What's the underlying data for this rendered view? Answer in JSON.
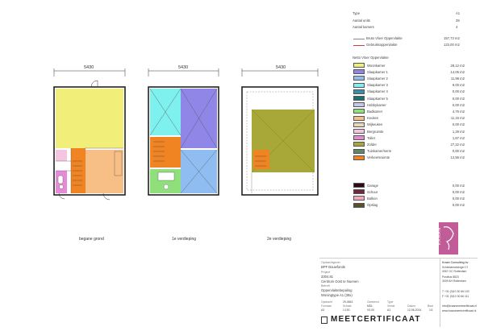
{
  "plans": {
    "dimension": "5430",
    "labels": [
      "begane grond",
      "1e verdieping",
      "2e verdieping"
    ]
  },
  "summary": {
    "type_label": "Type",
    "type_value": "A1",
    "aantal_units_label": "Aantal units",
    "aantal_units_value": "39",
    "aantal_kamers_label": "Aantal kamers",
    "aantal_kamers_value": "4",
    "bvo_label": "Bruto Vloer Oppervlakte",
    "bvo_value": "157,73 m2",
    "go_label": "Gebruiksoppervlakte",
    "go_value": "123,00 m2",
    "nvo_heading": "Netto Vloer Oppervlakte"
  },
  "legend": [
    {
      "label": "Woonkamer",
      "value": "28,12 m2",
      "color": "#f2ee7a"
    },
    {
      "label": "Slaapkamer 1",
      "value": "14,05 m2",
      "color": "#8f86e8"
    },
    {
      "label": "Slaapkamer 2",
      "value": "11,98 m2",
      "color": "#8fbdf2"
    },
    {
      "label": "Slaapkamer 3",
      "value": "9,00 m2",
      "color": "#7ef0ee"
    },
    {
      "label": "Slaapkamer 4",
      "value": "0,00 m2",
      "color": "#3a8fa8"
    },
    {
      "label": "Slaapkamer 5",
      "value": "0,00 m2",
      "color": "#1e6f6f"
    },
    {
      "label": "Hobbykamer",
      "value": "0,00 m2",
      "color": "#c4c8ec"
    },
    {
      "label": "Badkamer",
      "value": "4,76 m2",
      "color": "#8fe07a"
    },
    {
      "label": "Keuken",
      "value": "11,15 m2",
      "color": "#f7be86"
    },
    {
      "label": "Wijkeuken",
      "value": "0,00 m2",
      "color": "#ead7b7"
    },
    {
      "label": "Bergruimte",
      "value": "1,29 m2",
      "color": "#f5c4e0"
    },
    {
      "label": "Toilet",
      "value": "1,67 m2",
      "color": "#e68ad8"
    },
    {
      "label": "Zolder",
      "value": "27,22 m2",
      "color": "#a8a838"
    },
    {
      "label": "Tuinkamer/serre",
      "value": "0,00 m2",
      "color": "#5a8a6a"
    },
    {
      "label": "Verkeersruimte",
      "value": "12,56 m2",
      "color": "#f08422"
    }
  ],
  "legend2": [
    {
      "label": "Garage",
      "value": "0,00 m2",
      "color": "#2a0c16"
    },
    {
      "label": "Schuur",
      "value": "0,00 m2",
      "color": "#6e2a3a"
    },
    {
      "label": "Balkon",
      "value": "0,00 m2",
      "color": "#f2a8b8"
    },
    {
      "label": "Opslag",
      "value": "0,00 m2",
      "color": "#5a5226"
    }
  ],
  "logo": {
    "text": "KRAAN"
  },
  "titleblock": {
    "opdrachtgever_label": "Opdrachtgever",
    "opdrachtgever": "BPF Bouwfonds",
    "project_label": "Project",
    "project_nr": "3304.81",
    "project_name": "Centrum Oost te Nuenen",
    "betreft_label": "Betreft",
    "betreft": "Oppervlaktebepaling",
    "woningtype": "Woningtype A1 (39x)",
    "meta_headers": [
      "Opdracht",
      "Formaat",
      "Blad"
    ],
    "meta_values": [
      "29-0843",
      "Schaal",
      "Datum"
    ],
    "meta_row2": [
      "A3",
      "1:100",
      "12-06-2014"
    ],
    "meta_headers2": [
      "Getekend",
      "Versie",
      "Type"
    ],
    "meta_values2": [
      "MDL",
      "V0-00",
      "A1"
    ],
    "blad_value": "1/1",
    "certificate": "MEETCERTIFICAAT"
  },
  "company": {
    "name": "Kraan Consulting bv",
    "address1": "Schiedamsesingel 17",
    "address2": "3067 GC Rotterdam",
    "address3": "Postbus 8823",
    "address4": "3009 AH Rotterdam",
    "tel": "T +31 (0)10 30 66 100",
    "fax": "F +31 (0)10 30 66 111",
    "email": "info@kraanmeetcertificaat.nl",
    "web": "www.kraanmeetcertificaat.nl"
  }
}
